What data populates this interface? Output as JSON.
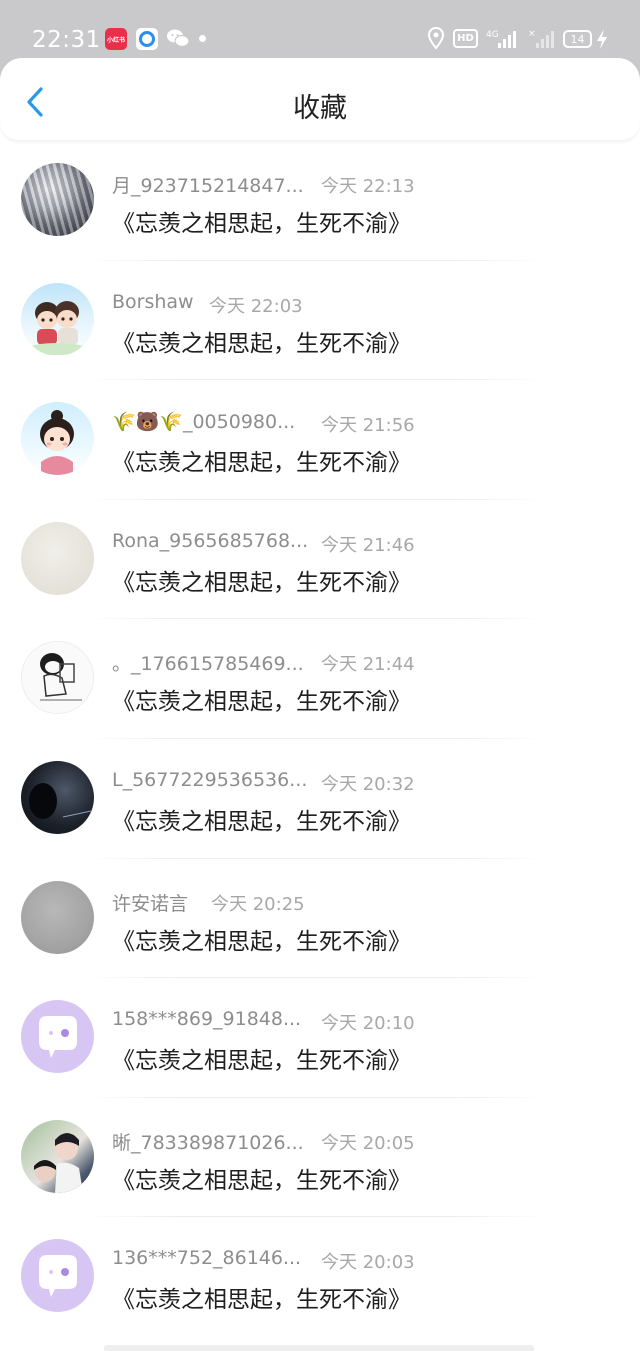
{
  "status_bar": {
    "time": "22:31",
    "app_badge_text": "小红书",
    "hd_label": "HD",
    "network_label": "4G",
    "battery_level": "14",
    "colors": {
      "background": "#c9c9cb",
      "foreground": "#ffffff"
    },
    "icons": [
      "xiaohongshu-app-icon",
      "blue-app-icon",
      "wechat-icon",
      "notification-dot-icon",
      "location-icon",
      "hd-icon",
      "signal-icon",
      "signal-icon-2",
      "battery-icon",
      "charging-bolt-icon"
    ]
  },
  "header": {
    "title": "收藏",
    "back_icon": "chevron-left-icon",
    "accent_color": "#2a9ae8"
  },
  "list": {
    "items": [
      {
        "username": "月_923715214847...",
        "time": "今天 22:13",
        "message": "《忘羡之相思起，生死不渝》",
        "avatar": "snowy-landscape-avatar"
      },
      {
        "username": "Borshaw",
        "time": "今天 22:03",
        "message": "《忘羡之相思起，生死不渝》",
        "avatar": "cartoon-couple-avatar"
      },
      {
        "username": "🌾🐻🌾_0050980...",
        "time": "今天 21:56",
        "message": "《忘羡之相思起，生死不渝》",
        "avatar": "cartoon-girl-avatar"
      },
      {
        "username": "Rona_9565685768...",
        "time": "今天 21:46",
        "message": "《忘羡之相思起，生死不渝》",
        "avatar": "beige-plain-avatar"
      },
      {
        "username": "。_176615785469...",
        "time": "今天 21:44",
        "message": "《忘羡之相思起，生死不渝》",
        "avatar": "sketch-character-avatar"
      },
      {
        "username": "L_5677229536536...",
        "time": "今天 20:32",
        "message": "《忘羡之相思起，生死不渝》",
        "avatar": "dark-silhouette-avatar"
      },
      {
        "username": "许安诺言",
        "time": "今天 20:25",
        "message": "《忘羡之相思起，生死不渝》",
        "avatar": "grey-plain-avatar"
      },
      {
        "username": "158***869_91848...",
        "time": "今天 20:10",
        "message": "《忘羡之相思起，生死不渝》",
        "avatar": "default-chat-bubble-avatar"
      },
      {
        "username": "晰_783389871026...",
        "time": "今天 20:05",
        "message": "《忘羡之相思起，生死不渝》",
        "avatar": "drama-photo-avatar"
      },
      {
        "username": "136***752_86146...",
        "time": "今天 20:03",
        "message": "《忘羡之相思起，生死不渝》",
        "avatar": "default-chat-bubble-avatar"
      }
    ]
  }
}
